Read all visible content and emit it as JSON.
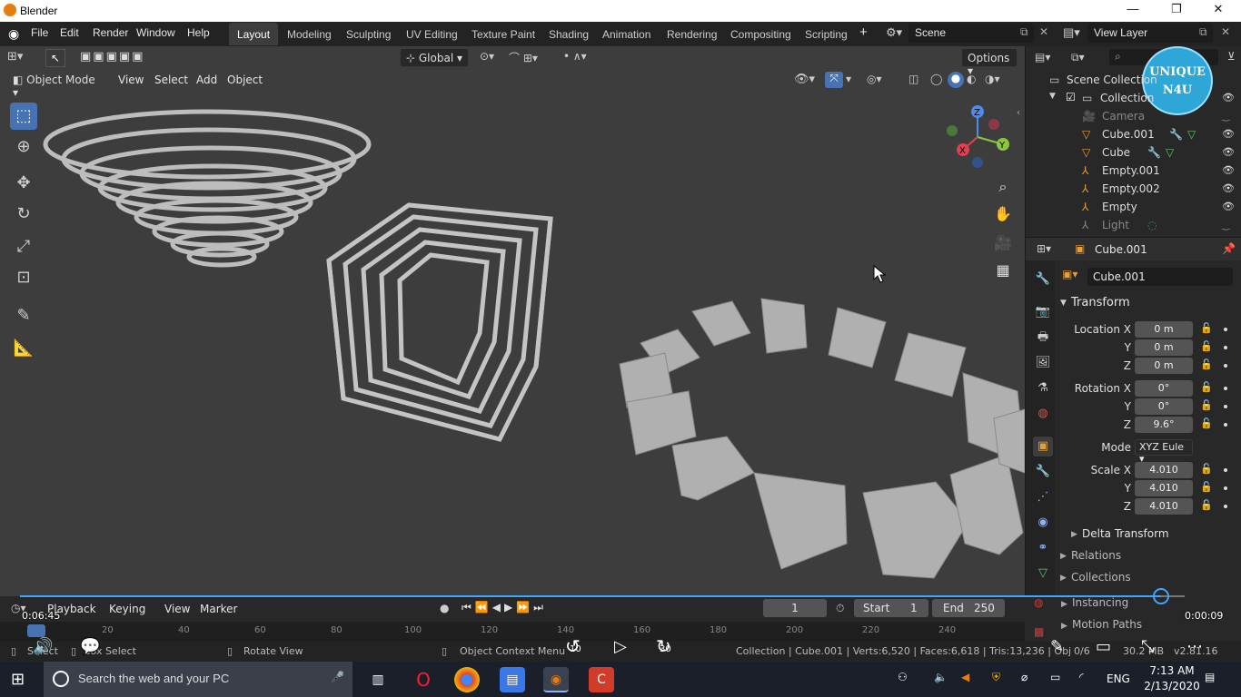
{
  "window": {
    "title": "Blender",
    "controls": {
      "minimize": "—",
      "maximize": "❐",
      "close": "✕"
    }
  },
  "menubar": {
    "menus": [
      "File",
      "Edit",
      "Render",
      "Window",
      "Help"
    ],
    "workspaces": [
      "Layout",
      "Modeling",
      "Sculpting",
      "UV Editing",
      "Texture Paint",
      "Shading",
      "Animation",
      "Rendering",
      "Compositing",
      "Scripting"
    ],
    "active_workspace": "Layout",
    "add_workspace": "+",
    "scene": "Scene",
    "view_layer": "View Layer"
  },
  "viewport_header": {
    "orientation": "Global",
    "options": "Options",
    "mode": "Object Mode",
    "menus": [
      "View",
      "Select",
      "Add",
      "Object"
    ]
  },
  "gizmo": {
    "x": "X",
    "y": "Y",
    "z": "Z"
  },
  "watermark": {
    "line1": "UNIQUE",
    "line2": "N4U"
  },
  "outliner": {
    "root": "Scene Collection",
    "collection": "Collection",
    "items": [
      "Camera",
      "Cube.001",
      "Cube",
      "Empty.001",
      "Empty.002",
      "Empty",
      "Light"
    ]
  },
  "properties": {
    "object_name": "Cube.001",
    "data_name": "Cube.001",
    "transform_title": "Transform",
    "location": {
      "label": "Location X",
      "x": "0 m",
      "y": "0 m",
      "z": "0 m"
    },
    "rotation": {
      "label": "Rotation X",
      "x": "0°",
      "y": "0°",
      "z": "9.6°"
    },
    "mode_label": "Mode",
    "mode_value": "XYZ Eule",
    "scale": {
      "label": "Scale X",
      "x": "4.010",
      "y": "4.010",
      "z": "4.010"
    },
    "axis_y": "Y",
    "axis_z": "Z",
    "sections": [
      "Delta Transform",
      "Relations",
      "Collections",
      "Instancing",
      "Motion Paths"
    ]
  },
  "timeline": {
    "menus": [
      "Playback",
      "Keying",
      "View",
      "Marker"
    ],
    "current_frame": "1",
    "start_label": "Start",
    "start": "1",
    "end_label": "End",
    "end": "250",
    "ruler": [
      "20",
      "40",
      "60",
      "80",
      "100",
      "120",
      "140",
      "160",
      "180",
      "200",
      "220",
      "240"
    ]
  },
  "video_player": {
    "elapsed": "0:06:45",
    "remaining": "0:00:09",
    "progress": 0.98,
    "skip_back": "10",
    "skip_forward": "30",
    "more": "⋯"
  },
  "statusbar": {
    "select": "Select",
    "box_select": "Box Select",
    "rotate_view": "Rotate View",
    "context_menu": "Object Context Menu",
    "stats": "Collection | Cube.001 | Verts:6,520 | Faces:6,618 | Tris:13,236 | Obj",
    "stats_tail": "0/6",
    "memory": "30.2 MB",
    "version": "v2.81.16"
  },
  "taskbar": {
    "search_placeholder": "Search the web and your PC",
    "time": "7:13 AM",
    "date": "2/13/2020",
    "language": "ENG"
  }
}
